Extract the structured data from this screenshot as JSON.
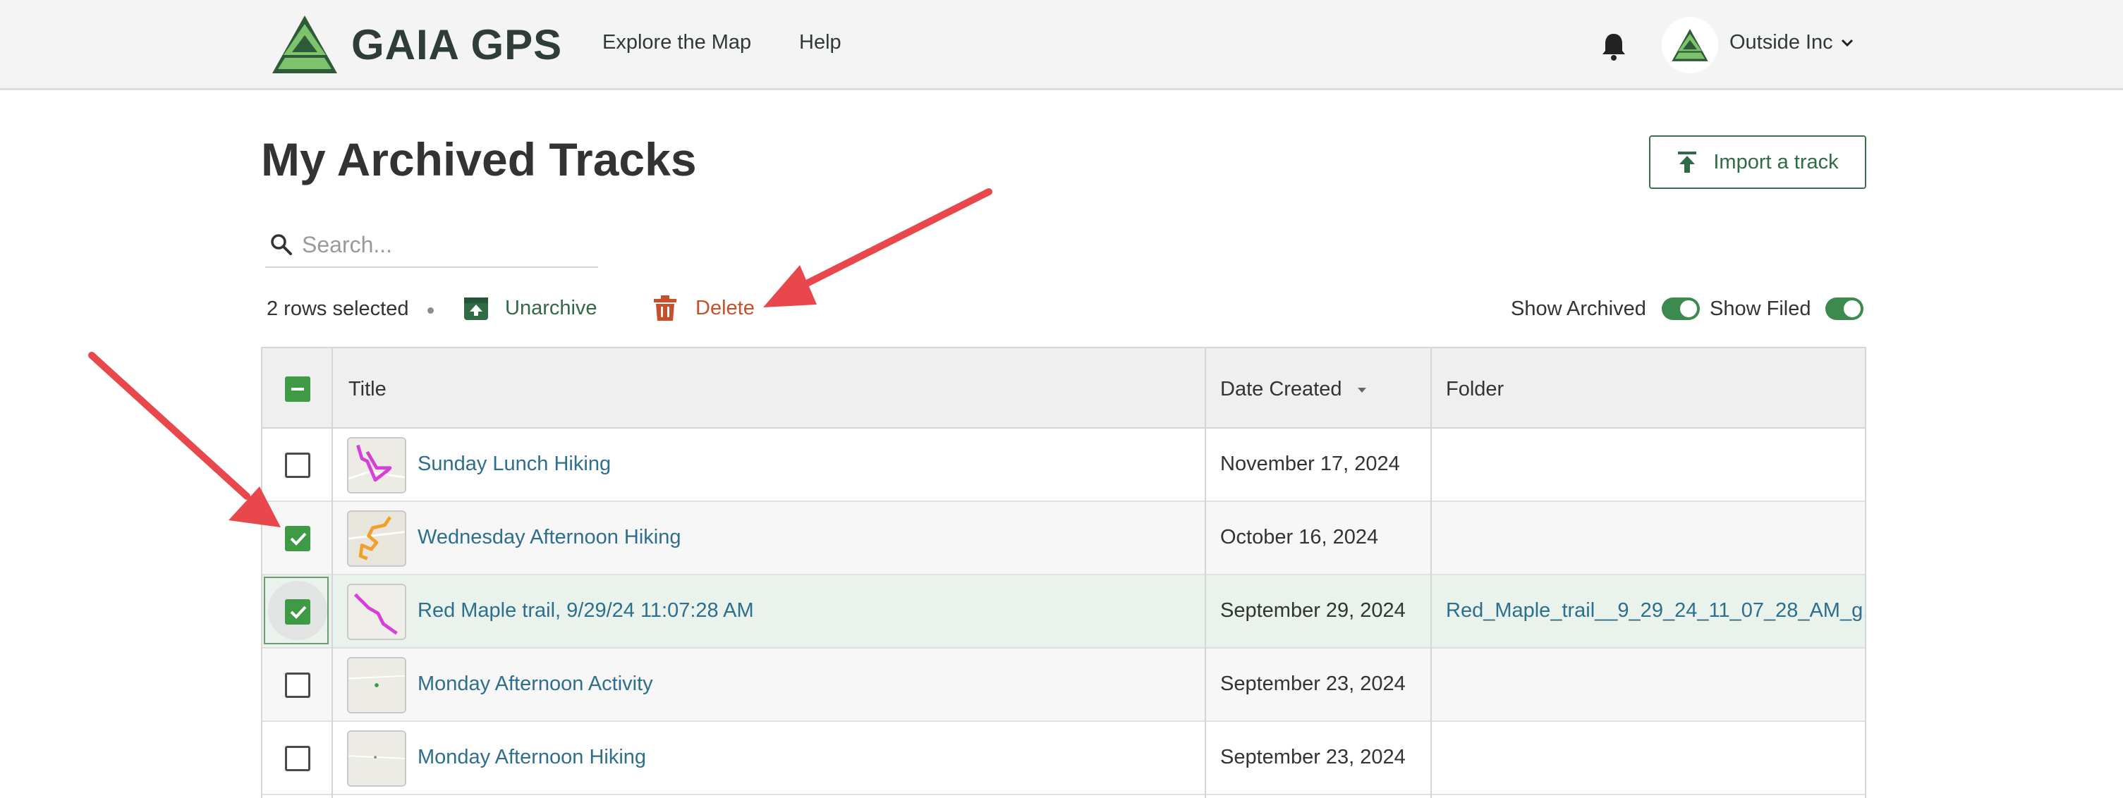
{
  "brand": {
    "name": "GAIA GPS"
  },
  "nav": {
    "explore": "Explore the Map",
    "help": "Help"
  },
  "account": {
    "name": "Outside Inc"
  },
  "page": {
    "title": "My Archived Tracks"
  },
  "import_button": {
    "label": "Import a track"
  },
  "search": {
    "placeholder": "Search..."
  },
  "actions": {
    "selected": "2 rows selected",
    "unarchive": "Unarchive",
    "delete": "Delete"
  },
  "toggles": {
    "show_archived": {
      "label": "Show Archived",
      "on": true
    },
    "show_filed": {
      "label": "Show Filed",
      "on": true
    }
  },
  "table": {
    "columns": {
      "title": "Title",
      "date": "Date Created",
      "folder": "Folder"
    },
    "rows": [
      {
        "title": "Sunday Lunch Hiking",
        "date": "November 17, 2024",
        "folder": "",
        "checked": false
      },
      {
        "title": "Wednesday Afternoon Hiking",
        "date": "October 16, 2024",
        "folder": "",
        "checked": true
      },
      {
        "title": "Red Maple trail, 9/29/24 11:07:28 AM",
        "date": "September 29, 2024",
        "folder": "Red_Maple_trail__9_29_24_11_07_28_AM_g...",
        "checked": true
      },
      {
        "title": "Monday Afternoon Activity",
        "date": "September 23, 2024",
        "folder": "",
        "checked": false
      },
      {
        "title": "Monday Afternoon Hiking",
        "date": "September 23, 2024",
        "folder": "",
        "checked": false
      }
    ]
  },
  "colors": {
    "accent_green": "#3e9a44",
    "delete_red": "#c7502a",
    "link_blue": "#2d6f8c",
    "annotation_arrow": "#e8474b"
  }
}
